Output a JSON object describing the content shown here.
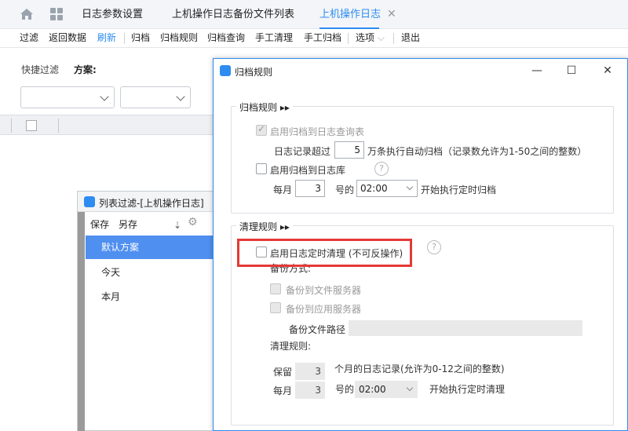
{
  "tabs": [
    {
      "label": "日志参数设置"
    },
    {
      "label": "上机操作日志备份文件列表"
    },
    {
      "label": "上机操作日志",
      "close": "✕"
    }
  ],
  "toolbar": {
    "items": [
      "过滤",
      "返回数据",
      "刷新",
      "归档",
      "归档规则",
      "归档查询",
      "手工清理",
      "手工归档",
      "选项",
      "退出"
    ]
  },
  "left": {
    "quick_filter": "快捷过滤",
    "scheme": "方案:"
  },
  "list_filter": {
    "title": "列表过滤-[上机操作日志]",
    "save": "保存",
    "save_as": "另存",
    "items": [
      "默认方案",
      "今天",
      "本月"
    ]
  },
  "dialog": {
    "title": "归档规则",
    "buttons": {
      "minimize": "—",
      "maximize": "☐",
      "close": "✕"
    },
    "archive": {
      "group_title": "归档规则 ▸▸",
      "enable_query_table": "启用归档到日志查询表",
      "record_exceed": "日志记录超过",
      "record_value": "5",
      "record_suffix": "万条执行自动归档（记录数允许为1-50之间的整数）",
      "enable_log_db": "启用归档到日志库",
      "monthly": "每月",
      "day_value": "3",
      "day_suffix": "号的",
      "time_value": "02:00",
      "start_text": "开始执行定时归档"
    },
    "cleanup": {
      "group_title": "清理规则 ▸▸",
      "enable_cleanup": "启用日志定时清理 (不可反操作)",
      "backup_mode": "备份方式:",
      "backup_file_server": "备份到文件服务器",
      "backup_app_server": "备份到应用服务器",
      "backup_path": "备份文件路径",
      "rule_label": "清理规则:",
      "keep": "保留",
      "keep_value": "3",
      "keep_suffix": "个月的日志记录(允许为0-12之间的整数)",
      "monthly": "每月",
      "day_value": "3",
      "day_suffix": "号的",
      "time_value": "02:00",
      "start_text": "开始执行定时清理"
    }
  },
  "colors": {
    "accent": "#2d8cf0",
    "highlight": "#e53935",
    "selected": "#4f8ff0"
  }
}
